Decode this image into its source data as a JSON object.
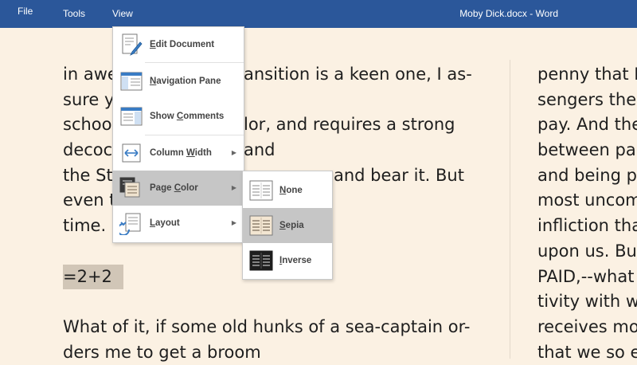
{
  "menubar": {
    "file": "File",
    "tools": "Tools",
    "view": "View"
  },
  "window": {
    "title": "Moby Dick.docx - Word"
  },
  "document": {
    "left_column": [
      "in awe",
      "sure y",
      "schoo",
      "decoc",
      "the St",
      "even t",
      "time.",
      "",
      "=2+2",
      "",
      "What of it, if some old hunks of a sea-captain or-",
      "ders me to get a broom"
    ],
    "left_column_right_fragments": [
      "ansition is a keen one, I as-",
      "",
      "lor, and requires a strong",
      "and",
      "and bear it. But",
      "",
      "",
      "",
      "",
      "",
      "",
      ""
    ],
    "right_column": [
      "penny that I",
      "sengers the",
      "pay. And the",
      "between pa",
      "and being p",
      "most uncom",
      "infliction tha",
      "upon us. Bu",
      "PAID,--what",
      "tivity with w",
      "receives mo",
      "that we so e"
    ],
    "background_color": "#fbf1e3",
    "selection_color": "#d1c6b7"
  },
  "view_menu": {
    "items": [
      {
        "label_prefix": "",
        "label_underlined": "E",
        "label_rest": "dit Document",
        "icon": "edit-document-icon",
        "has_submenu": false
      },
      {
        "label_prefix": "",
        "label_underlined": "N",
        "label_rest": "avigation Pane",
        "icon": "navigation-pane-icon",
        "has_submenu": false
      },
      {
        "label_prefix": "Show ",
        "label_underlined": "C",
        "label_rest": "omments",
        "icon": "show-comments-icon",
        "has_submenu": false
      },
      {
        "label_prefix": "Column ",
        "label_underlined": "W",
        "label_rest": "idth",
        "icon": "column-width-icon",
        "has_submenu": true
      },
      {
        "label_prefix": "Page ",
        "label_underlined": "C",
        "label_rest": "olor",
        "icon": "page-color-icon",
        "has_submenu": true,
        "selected": true
      },
      {
        "label_prefix": "",
        "label_underlined": "L",
        "label_rest": "ayout",
        "icon": "layout-icon",
        "has_submenu": true
      }
    ]
  },
  "page_color_submenu": {
    "items": [
      {
        "label_prefix": "",
        "label_underlined": "N",
        "label_rest": "one",
        "icon": "page-none-icon"
      },
      {
        "label_prefix": "",
        "label_underlined": "S",
        "label_rest": "epia",
        "icon": "page-sepia-icon",
        "selected": true
      },
      {
        "label_prefix": "",
        "label_underlined": "I",
        "label_rest": "nverse",
        "icon": "page-inverse-icon"
      }
    ]
  },
  "colors": {
    "titlebar": "#2b579a",
    "menu_selected": "#c6c6c6",
    "accent_blue": "#2e73b8"
  }
}
